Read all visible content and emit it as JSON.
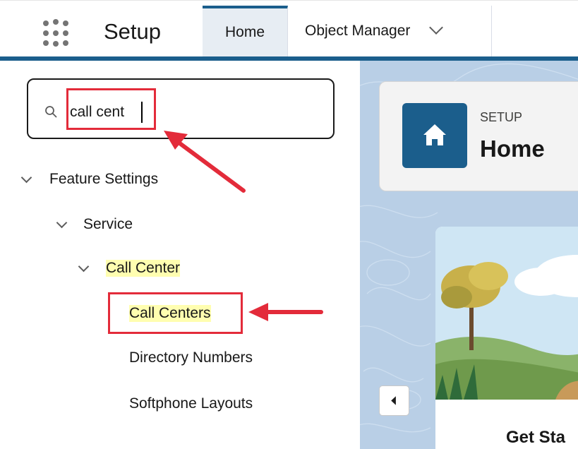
{
  "header": {
    "app_title": "Setup",
    "tabs": [
      {
        "label": "Home",
        "active": true
      },
      {
        "label": "Object Manager",
        "has_dropdown": true
      }
    ],
    "icons": {
      "app_launcher": "app-launcher-grid-icon",
      "dropdown": "chevron-down-icon"
    },
    "accent_color": "#1b5e8c"
  },
  "sidebar": {
    "search": {
      "value": "call cent",
      "icon": "search-icon"
    },
    "tree": [
      {
        "label": "Feature Settings",
        "level": 0,
        "expanded": true
      },
      {
        "label": "Service",
        "level": 1,
        "expanded": true
      },
      {
        "label": "Call Center",
        "level": 2,
        "expanded": true,
        "match": true
      },
      {
        "label": "Call Centers",
        "level": 3,
        "match": true
      },
      {
        "label": "Directory Numbers",
        "level": 3
      },
      {
        "label": "Softphone Layouts",
        "level": 3
      }
    ],
    "match_highlight_color": "#fffeb0"
  },
  "main": {
    "setup_card": {
      "eyebrow": "SETUP",
      "title": "Home",
      "icon": "home-icon"
    },
    "get_started_card": {
      "title": "Get Sta"
    },
    "collapse_button": {
      "icon": "chevron-left-icon"
    }
  },
  "annotations": {
    "color": "#e32b3a",
    "boxes": [
      "search-input-value",
      "call-centers-item"
    ],
    "arrows": [
      "arrow-to-search",
      "arrow-to-call-centers"
    ]
  }
}
